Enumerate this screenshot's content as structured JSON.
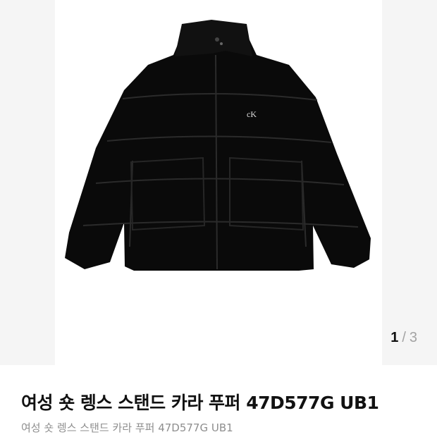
{
  "gallery": {
    "current": "1",
    "separator": "/",
    "total": "3",
    "image_alt": "black puffer jacket"
  },
  "product": {
    "title": "여성 숏 렝스 스탠드 카라 푸퍼 47D577G UB1",
    "subtitle": "여성 숏 렝스 스탠드 카라 푸퍼 47D577G UB1",
    "logo": "cK"
  },
  "colors": {
    "jacket": "#0a0a0a",
    "stage_bg": "#f5f5f5",
    "muted_text": "#8e8e8e"
  }
}
